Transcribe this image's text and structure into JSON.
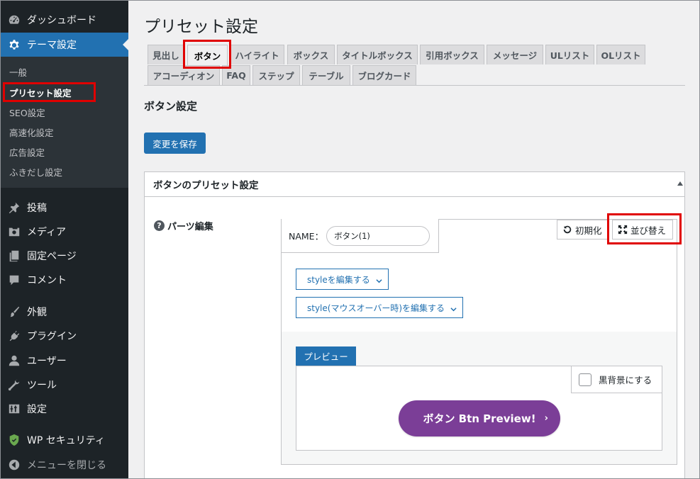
{
  "sidebar": {
    "items": [
      {
        "label": "ダッシュボード",
        "icon": "dashboard-icon"
      },
      {
        "label": "テーマ設定",
        "icon": "gear-icon"
      },
      {
        "label": "投稿",
        "icon": "pin-icon"
      },
      {
        "label": "メディア",
        "icon": "media-icon"
      },
      {
        "label": "固定ページ",
        "icon": "page-icon"
      },
      {
        "label": "コメント",
        "icon": "comment-icon"
      },
      {
        "label": "外観",
        "icon": "brush-icon"
      },
      {
        "label": "プラグイン",
        "icon": "plugin-icon"
      },
      {
        "label": "ユーザー",
        "icon": "user-icon"
      },
      {
        "label": "ツール",
        "icon": "wrench-icon"
      },
      {
        "label": "設定",
        "icon": "settings-sliders-icon"
      },
      {
        "label": "WP セキュリティ",
        "icon": "shield-icon"
      },
      {
        "label": "メニューを閉じる",
        "icon": "collapse-arrow-icon"
      }
    ],
    "submenu": [
      "一般",
      "プリセット設定",
      "SEO設定",
      "高速化設定",
      "広告設定",
      "ふきだし設定"
    ],
    "active_color": "#2271b1"
  },
  "page": {
    "title": "プリセット設定",
    "tabs_row1": [
      "見出し",
      "ボタン",
      "ハイライト",
      "ボックス",
      "タイトルボックス",
      "引用ボックス",
      "メッセージ",
      "ULリスト",
      "OLリスト"
    ],
    "tabs_row2": [
      "アコーディオン",
      "FAQ",
      "ステップ",
      "テーブル",
      "ブログカード"
    ],
    "section_title": "ボタン設定",
    "save_label": "変更を保存"
  },
  "panel": {
    "title": "ボタンのプリセット設定",
    "parts_label": "パーツ編集",
    "name_label": "NAME：",
    "name_value": "ボタン(1)",
    "reset_label": "初期化",
    "sort_label": "並び替え",
    "style_edit_label": "styleを編集する",
    "style_hover_label": "style(マウスオーバー時)を編集する",
    "preview_label": "プレビュー",
    "dark_bg_label": "黒背景にする",
    "preview_button_label": "ボタン Btn Preview!",
    "preview_button_arrow": "›",
    "preview_button_color": "#7b3e97"
  }
}
